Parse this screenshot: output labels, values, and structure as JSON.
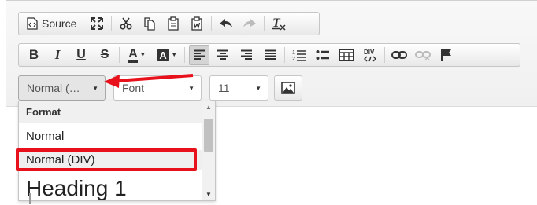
{
  "toolbar": {
    "source_label": "Source",
    "icons_row1": [
      "source-icon",
      "maximize-icon",
      "cut-icon",
      "copy-icon",
      "paste-icon",
      "paste-word-icon",
      "undo-icon",
      "redo-icon",
      "remove-format-icon"
    ],
    "row2": {
      "bold": "B",
      "italic": "I",
      "underline": "U",
      "strike": "S",
      "text_color": "A",
      "bg_color": "A"
    }
  },
  "combos": {
    "format": "Normal (…",
    "font": "Font",
    "size": "11"
  },
  "dropdown": {
    "title": "Format",
    "items": [
      "Normal",
      "Normal (DIV)",
      "Heading 1"
    ],
    "selected_index": 1
  },
  "colors": {
    "annotation_red": "#e8101a",
    "toolbar_bg": "#f0f0f0"
  }
}
